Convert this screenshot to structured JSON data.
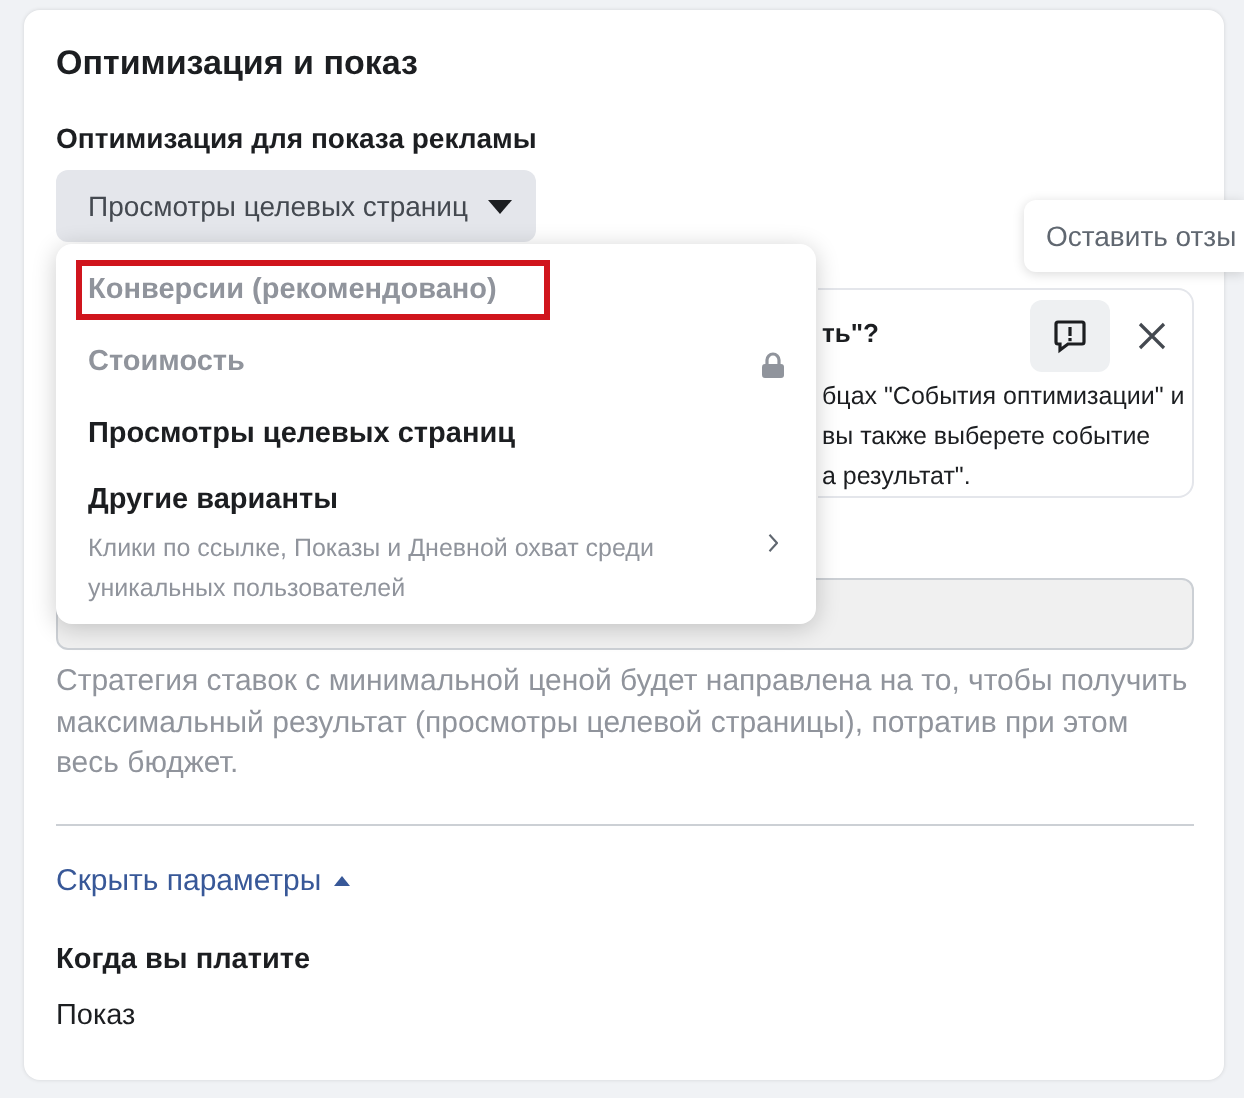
{
  "section": {
    "title": "Оптимизация и показ"
  },
  "optimization": {
    "label": "Оптимизация для показа рекламы",
    "value": "Просмотры целевых страниц",
    "open": true
  },
  "menu": [
    {
      "kind": "option",
      "label": "Конверсии (рекомендовано)",
      "disabled": true,
      "locked": false,
      "outlined": true
    },
    {
      "kind": "option",
      "label": "Стоимость",
      "disabled": true,
      "locked": true,
      "outlined": false
    },
    {
      "kind": "option",
      "label": "Просмотры целевых страниц",
      "disabled": false,
      "locked": false,
      "outlined": false
    },
    {
      "kind": "submenu",
      "label": "Другие варианты",
      "description": "Клики по ссылке, Показы и Дневной охват среди уникальных пользователей",
      "disabled": false
    }
  ],
  "feedback_tooltip": {
    "text": "Оставить отзы"
  },
  "info_card": {
    "title": "ть\"?",
    "lines": [
      "бцах \"События оптимизации\" и",
      "вы также выберете событие",
      "а результат\"."
    ]
  },
  "strategy_description": "Стратегия ставок с минимальной ценой будет направлена на то, чтобы получить максимальный результат (просмотры целевой страницы), потратив при этом весь бюджет.",
  "toggle_link": {
    "label": "Скрыть параметры",
    "expanded": true
  },
  "billing": {
    "label": "Когда вы платите",
    "value": "Показ"
  }
}
